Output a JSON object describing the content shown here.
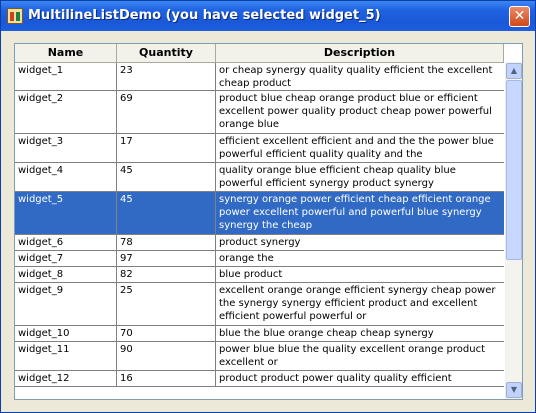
{
  "window": {
    "title": "MultilineListDemo (you have selected widget_5)",
    "close_symbol": "✕"
  },
  "table": {
    "headers": [
      "Name",
      "Quantity",
      "Description"
    ],
    "selected_index": 4,
    "rows": [
      {
        "name": "widget_1",
        "quantity": "23",
        "description": "or cheap synergy quality quality efficient the excellent cheap product"
      },
      {
        "name": "widget_2",
        "quantity": "69",
        "description": "product blue cheap orange product blue or efficient excellent power quality product cheap power powerful orange blue"
      },
      {
        "name": "widget_3",
        "quantity": "17",
        "description": "efficient excellent efficient and and the the power blue powerful efficient quality quality and the"
      },
      {
        "name": "widget_4",
        "quantity": "45",
        "description": "quality orange blue efficient cheap quality blue powerful efficient synergy product synergy"
      },
      {
        "name": "widget_5",
        "quantity": "45",
        "description": "synergy orange power efficient cheap efficient orange power excellent powerful and powerful blue synergy synergy the cheap"
      },
      {
        "name": "widget_6",
        "quantity": "78",
        "description": "product synergy"
      },
      {
        "name": "widget_7",
        "quantity": "97",
        "description": "orange the"
      },
      {
        "name": "widget_8",
        "quantity": "82",
        "description": "blue product"
      },
      {
        "name": "widget_9",
        "quantity": "25",
        "description": "excellent orange orange efficient synergy cheap power the synergy synergy efficient product and excellent efficient powerful powerful or"
      },
      {
        "name": "widget_10",
        "quantity": "70",
        "description": "blue the blue orange cheap cheap synergy"
      },
      {
        "name": "widget_11",
        "quantity": "90",
        "description": "power blue blue the quality excellent orange product excellent or"
      },
      {
        "name": "widget_12",
        "quantity": "16",
        "description": "product product power quality quality efficient"
      }
    ]
  },
  "colors": {
    "selection": "#316ac5",
    "titlebar": "#1f63e2"
  }
}
